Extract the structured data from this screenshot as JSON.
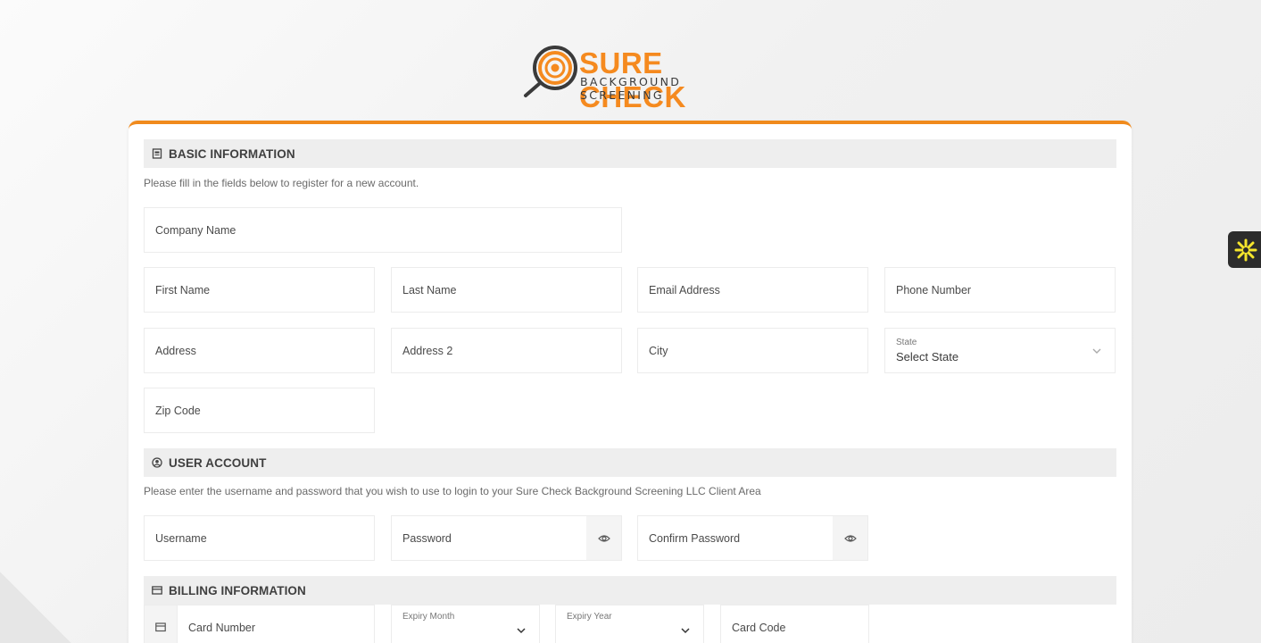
{
  "logo": {
    "brand_text": "SURE CHECK",
    "tagline": "BACKGROUND SCREENING",
    "brand_color": "#f58a1f"
  },
  "accent_color": "#f08a1c",
  "basic": {
    "title": "BASIC INFORMATION",
    "icon": "id-card-icon",
    "description": "Please fill in the fields below to register for a new account.",
    "company_name": "Company Name",
    "first_name": "First Name",
    "last_name": "Last Name",
    "email": "Email Address",
    "phone": "Phone Number",
    "address": "Address",
    "address2": "Address 2",
    "city": "City",
    "state_label": "State",
    "state_value": "Select State",
    "zip": "Zip Code"
  },
  "account": {
    "title": "USER ACCOUNT",
    "icon": "user-circle-icon",
    "description": "Please enter the username and password that you wish to use to login to your Sure Check Background Screening LLC Client Area",
    "username": "Username",
    "password": "Password",
    "confirm_password": "Confirm Password"
  },
  "billing": {
    "title": "BILLING INFORMATION",
    "icon": "credit-card-icon",
    "card_number": "Card Number",
    "expiry_month": "Expiry Month",
    "expiry_year": "Expiry Year",
    "card_code": "Card Code"
  },
  "side_widget": {
    "icon": "accessibility-star-icon",
    "color": "#f5e52c"
  }
}
